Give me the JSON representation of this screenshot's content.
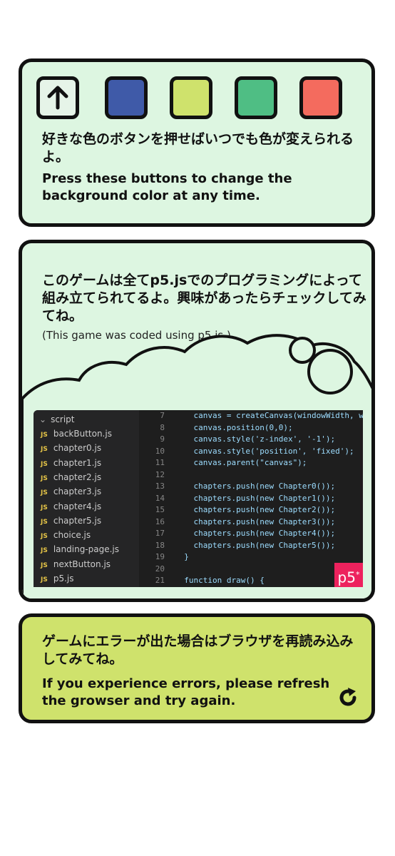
{
  "colors_card": {
    "up_icon": "arrow-up-icon",
    "swatches": [
      {
        "name": "blue",
        "color": "#3f5aa8"
      },
      {
        "name": "lime",
        "color": "#cfe26c"
      },
      {
        "name": "green",
        "color": "#4fbe84"
      },
      {
        "name": "coral",
        "color": "#f46b5e"
      }
    ],
    "text_jp": "好きな色のボタンを押せばいつでも色が変えられるよ。",
    "text_en": "Press these buttons to change the background color at any time."
  },
  "p5_card": {
    "text_jp": "このゲームは全てp5.jsでのプログラミングによって組み立てられてるよ。興味があったらチェックしてみてね。",
    "note": "(This game was coded using p5.js.)",
    "editor": {
      "folder": "script",
      "files": [
        "backButton.js",
        "chapter0.js",
        "chapter1.js",
        "chapter2.js",
        "chapter3.js",
        "chapter4.js",
        "chapter5.js",
        "choice.js",
        "landing-page.js",
        "nextButton.js",
        "p5.js"
      ],
      "lines": [
        {
          "n": "7",
          "t": "    canvas = createCanvas(windowWidth, w"
        },
        {
          "n": "8",
          "t": "    canvas.position(0,0);"
        },
        {
          "n": "9",
          "t": "    canvas.style('z-index', '-1');"
        },
        {
          "n": "10",
          "t": "    canvas.style('position', 'fixed');"
        },
        {
          "n": "11",
          "t": "    canvas.parent(\"canvas\");"
        },
        {
          "n": "12",
          "t": ""
        },
        {
          "n": "13",
          "t": "    chapters.push(new Chapter0());"
        },
        {
          "n": "14",
          "t": "    chapters.push(new Chapter1());"
        },
        {
          "n": "15",
          "t": "    chapters.push(new Chapter2());"
        },
        {
          "n": "16",
          "t": "    chapters.push(new Chapter3());"
        },
        {
          "n": "17",
          "t": "    chapters.push(new Chapter4());"
        },
        {
          "n": "18",
          "t": "    chapters.push(new Chapter5());"
        },
        {
          "n": "19",
          "t": "  }"
        },
        {
          "n": "20",
          "t": ""
        },
        {
          "n": "21",
          "t": "  function draw() {"
        }
      ],
      "badge": "p5",
      "badge_mark": "*"
    }
  },
  "error_card": {
    "text_jp": "ゲームにエラーが出た場合はブラウザを再読み込みしてみてね。",
    "text_en": "If you experience errors, please refresh the growser and try again.",
    "reload_icon": "reload-icon"
  }
}
